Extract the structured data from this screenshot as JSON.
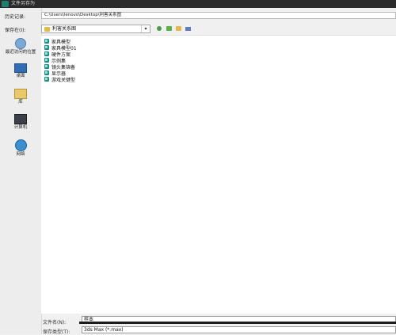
{
  "window": {
    "title": "文件另存为"
  },
  "path_row": {
    "label": "历史记录:",
    "value": "C:\\Users\\lenovo\\Desktop\\利害关系图"
  },
  "save_in": {
    "label": "保存在(I):",
    "value": "利害关系图"
  },
  "toolbar": {
    "back_icon": "back-arrow-icon",
    "up_icon": "up-folder-icon",
    "new_folder_icon": "new-folder-icon",
    "view_icon": "view-menu-icon"
  },
  "places": [
    {
      "label": "最近访问的位置",
      "icon": "recent-places-icon"
    },
    {
      "label": "桌面",
      "icon": "desktop-icon"
    },
    {
      "label": "库",
      "icon": "libraries-icon"
    },
    {
      "label": "计算机",
      "icon": "computer-icon"
    },
    {
      "label": "网络",
      "icon": "network-icon"
    }
  ],
  "files": [
    {
      "name": "家具模型"
    },
    {
      "name": "家具模型01"
    },
    {
      "name": "硬件方案"
    },
    {
      "name": "示例集"
    },
    {
      "name": "镜头集锦备"
    },
    {
      "name": "显示器"
    },
    {
      "name": "游戏关键型"
    }
  ],
  "file_name": {
    "label": "文件名(N):",
    "value": "样本"
  },
  "file_type": {
    "label": "保存类型(T):",
    "value": "3ds Max (*.max)"
  },
  "colors": {
    "accent": "#1f8f86",
    "folder": "#e3b94a",
    "titlebar": "#2b2b2b"
  }
}
